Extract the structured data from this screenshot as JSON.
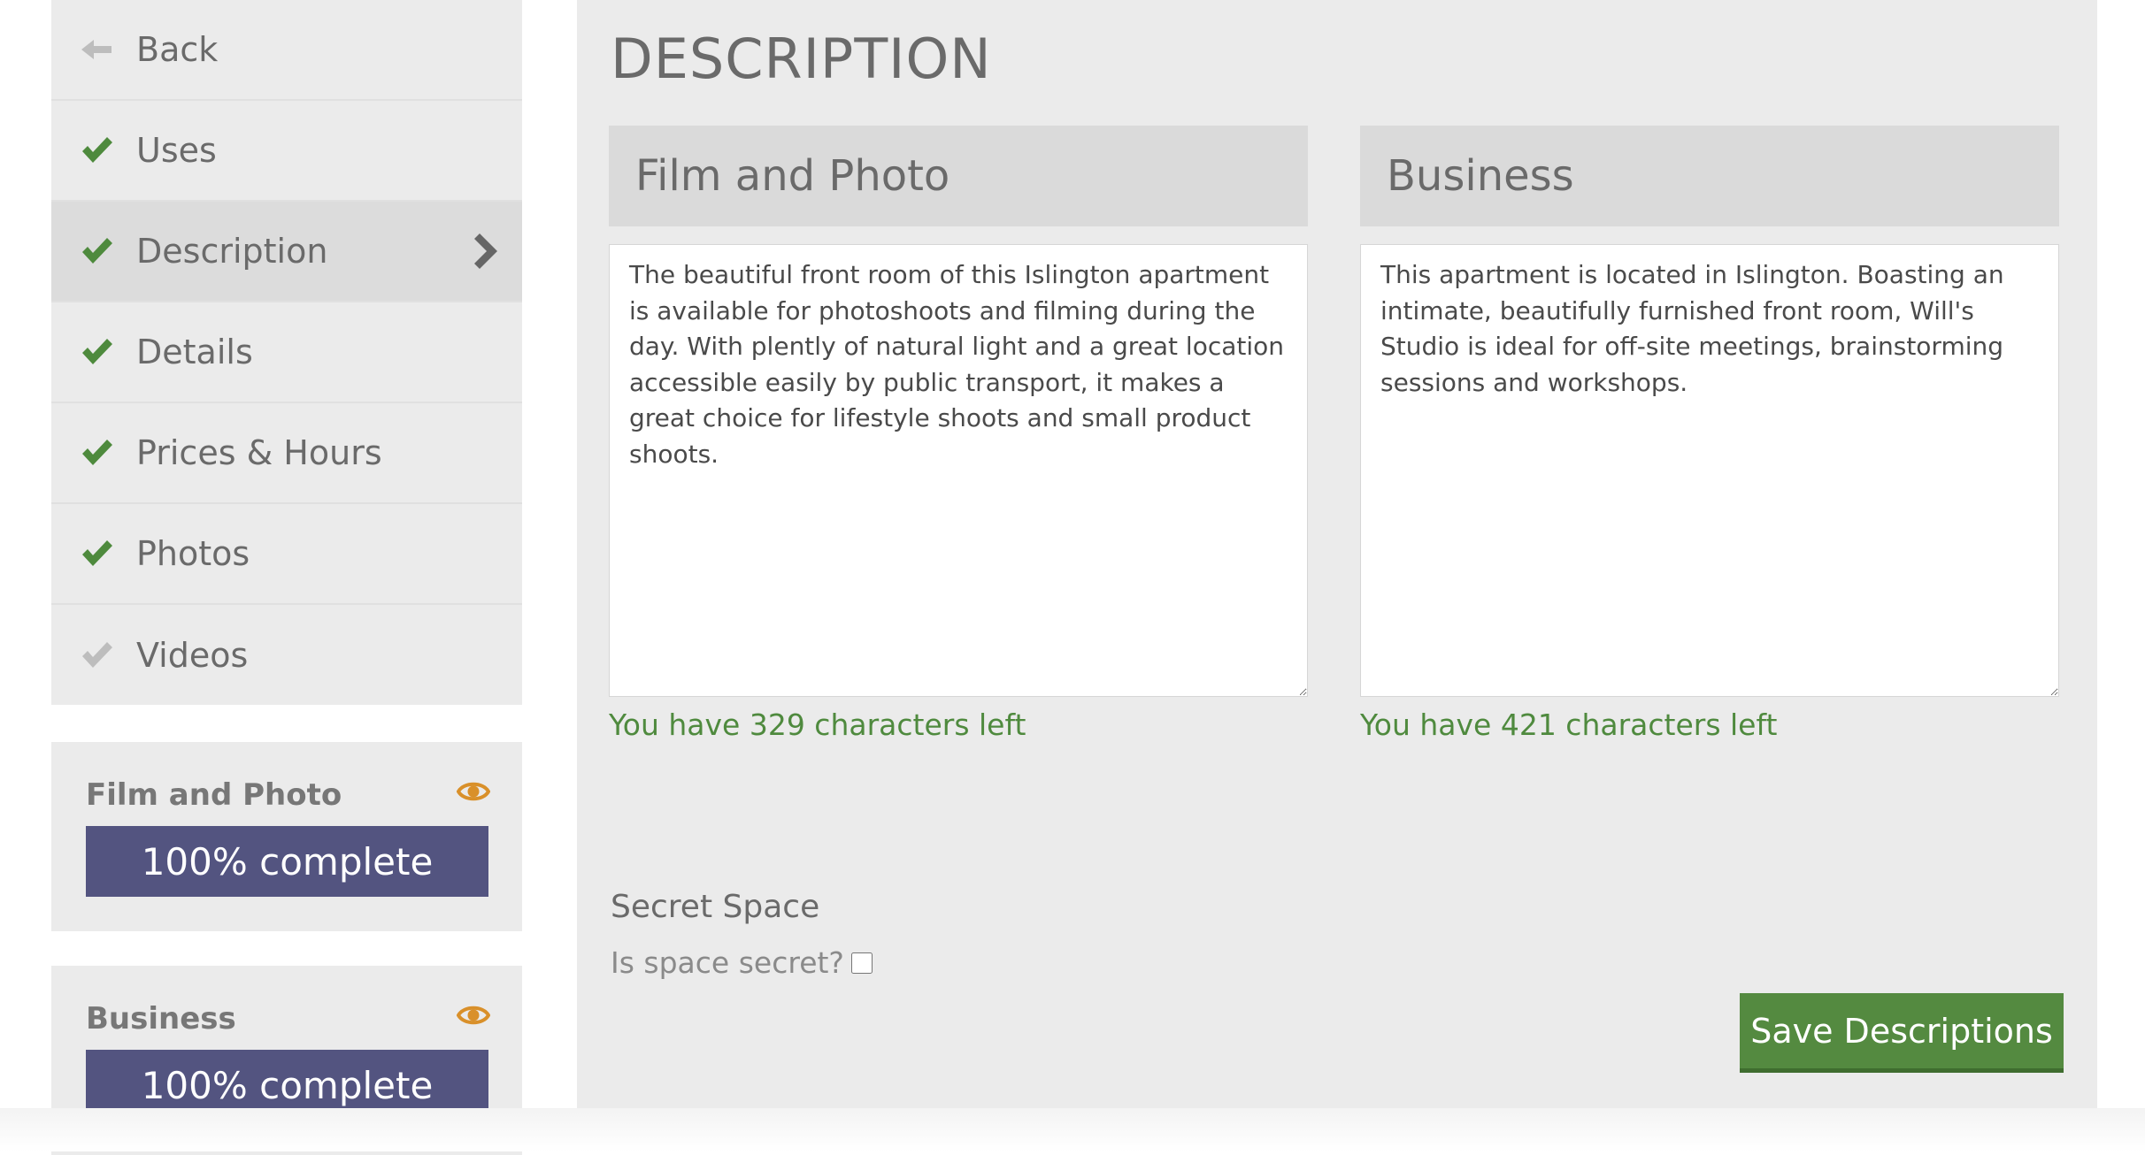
{
  "sidebar": {
    "items": [
      {
        "label": "Back",
        "icon": "arrow-left-icon",
        "status": "none"
      },
      {
        "label": "Uses",
        "icon": "check-icon",
        "status": "complete"
      },
      {
        "label": "Description",
        "icon": "check-icon",
        "status": "complete",
        "active": true
      },
      {
        "label": "Details",
        "icon": "check-icon",
        "status": "complete"
      },
      {
        "label": "Prices & Hours",
        "icon": "check-icon",
        "status": "complete"
      },
      {
        "label": "Photos",
        "icon": "check-icon",
        "status": "complete"
      },
      {
        "label": "Videos",
        "icon": "check-icon",
        "status": "incomplete"
      }
    ],
    "active_chevron_icon": "chevron-right-icon"
  },
  "cards": [
    {
      "title": "Film and Photo",
      "icon": "eye-icon",
      "progress_label": "100% complete",
      "progress": 1.0
    },
    {
      "title": "Business",
      "icon": "eye-icon",
      "progress_label": "100% complete",
      "progress": 1.0
    }
  ],
  "main": {
    "title": "DESCRIPTION",
    "columns": [
      {
        "header": "Film and Photo",
        "text": "The beautiful front room of this Islington apartment is available for photoshoots and filming during the day. With plently of natural light and a great location accessible easily by public transport, it makes a great choice for lifestyle shoots and small product shoots.",
        "counter": "You have 329 characters left"
      },
      {
        "header": "Business",
        "text": "This apartment is located in Islington. Boasting an intimate, beautifully furnished front room, Will's Studio is ideal for off-site meetings, brainstorming sessions and workshops.",
        "counter": "You have 421 characters left"
      }
    ],
    "secret": {
      "title": "Secret Space",
      "label": "Is space secret?",
      "checked": false
    },
    "save_label": "Save Descriptions"
  },
  "colors": {
    "check_complete": "#4e8a3d",
    "check_incomplete": "#bdbdbd",
    "back_arrow": "#bdbdbd",
    "chevron": "#666666",
    "eye": "#d9902a",
    "progress_fill": "#535480",
    "counter_text": "#4f8a3e",
    "save_button": "#548a40",
    "panel_bg": "#ebebeb",
    "header_bg": "#dadada"
  }
}
